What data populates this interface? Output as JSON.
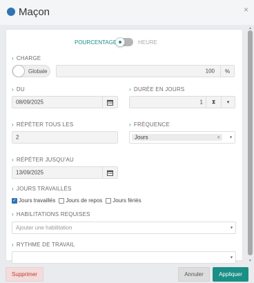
{
  "dialog": {
    "title": "Maçon",
    "close": "×"
  },
  "toggle": {
    "left": "POURCENTAGE",
    "right": "HEURE"
  },
  "charge": {
    "label": "CHARGE",
    "switch_label": "Globale",
    "value": "100",
    "unit": "%"
  },
  "du": {
    "label": "DU",
    "value": "08/09/2025"
  },
  "duree": {
    "label": "DURÉE EN JOURS",
    "value": "1",
    "icon": "⧗",
    "caret": "▾"
  },
  "repeter_tous": {
    "label": "RÉPÉTER TOUS LES",
    "value": "2"
  },
  "frequence": {
    "label": "FRÉQUENCE",
    "value": "Jours",
    "clear": "×",
    "caret": "▾"
  },
  "repeter_jusqu": {
    "label": "RÉPÉTER JUSQU'AU",
    "value": "13/09/2025"
  },
  "jours": {
    "label": "JOURS TRAVAILLÉS",
    "options": [
      {
        "label": "Jours travaillés",
        "checked": true
      },
      {
        "label": "Jours de repos",
        "checked": false
      },
      {
        "label": "Jours fériés",
        "checked": false
      }
    ]
  },
  "habilitations": {
    "label": "HABILITATIONS REQUISES",
    "placeholder": "Ajouter une habilitation",
    "caret": "▾"
  },
  "rythme": {
    "label": "RYTHME DE TRAVAIL",
    "value": "",
    "caret": "▾"
  },
  "buttons": {
    "delete": "Supprimer",
    "cancel": "Annuler",
    "apply": "Appliquer"
  },
  "chevron": "›",
  "check": "✓",
  "scroll": {
    "up": "▲",
    "down": "▼"
  },
  "colors": {
    "accent": "#1a8f86",
    "title_dot": "#2f74b5",
    "danger": "#c0392b"
  }
}
